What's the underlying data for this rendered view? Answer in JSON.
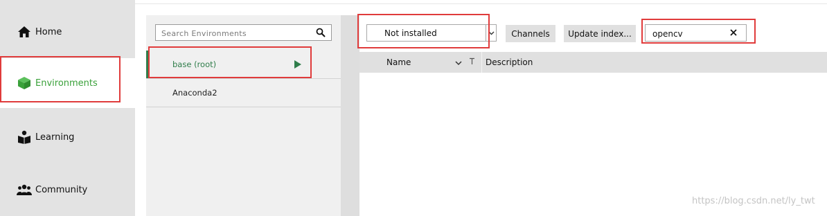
{
  "nav": {
    "items": [
      {
        "label": "Home",
        "icon": "home-icon"
      },
      {
        "label": "Environments",
        "icon": "cube-icon"
      },
      {
        "label": "Learning",
        "icon": "book-reader-icon"
      },
      {
        "label": "Community",
        "icon": "people-icon"
      }
    ],
    "active_color": "#3aa13a"
  },
  "environments": {
    "search_placeholder": "Search Environments",
    "items": [
      {
        "name": "base (root)"
      },
      {
        "name": "Anaconda2"
      }
    ]
  },
  "packages": {
    "filter_value": "Not installed",
    "channels_label": "Channels",
    "update_index_label": "Update index...",
    "search_value": "opencv",
    "columns": {
      "name": "Name",
      "description": "Description"
    }
  },
  "watermark": "https://blog.csdn.net/ly_twt",
  "colors": {
    "highlight": "#e03b3b",
    "accent_green": "#2f7d4a"
  }
}
